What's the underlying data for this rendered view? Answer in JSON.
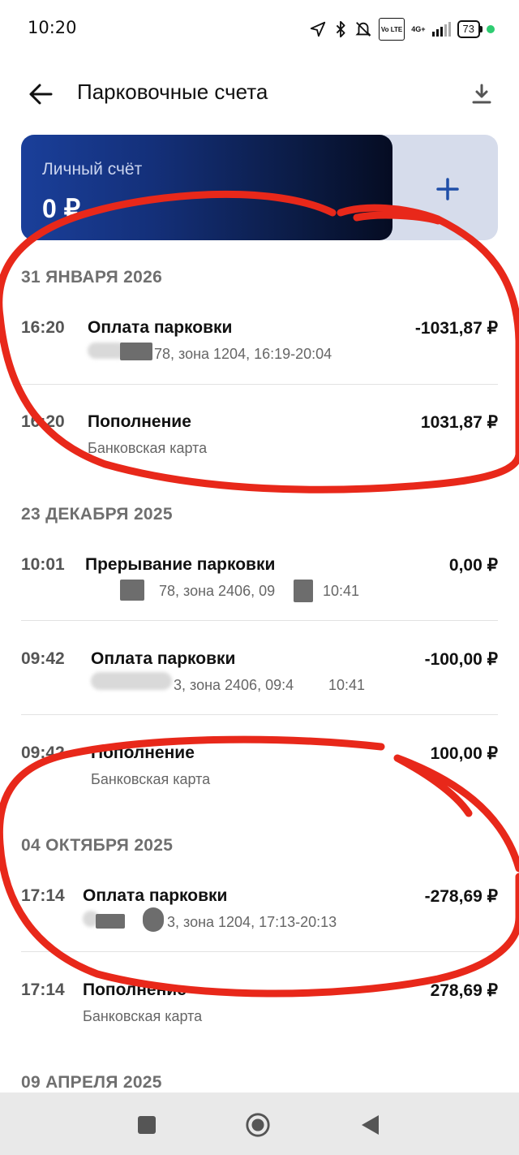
{
  "status_bar": {
    "time": "10:20",
    "lte_label": "Vo LTE",
    "network_label": "4G+",
    "battery": "73",
    "icons": [
      "location-icon",
      "bluetooth-icon",
      "bell-off-icon",
      "signal-icon",
      "battery-icon"
    ]
  },
  "header": {
    "title": "Парковочные счета"
  },
  "account_card": {
    "label": "Личный счёт",
    "balance": "0 ₽"
  },
  "transaction_groups": [
    {
      "date": "31 ЯНВАРЯ 2026",
      "items": [
        {
          "time": "16:20",
          "title": "Оплата парковки",
          "subtitle": "78, зона 1204, 16:19-20:04",
          "amount": "-1031,87 ₽"
        },
        {
          "time": "16:20",
          "title": "Пополнение",
          "subtitle": "Банковская карта",
          "amount": "1031,87 ₽"
        }
      ]
    },
    {
      "date": "23 ДЕКАБРЯ 2025",
      "items": [
        {
          "time": "10:01",
          "title": "Прерывание парковки",
          "subtitle": "78, зона 2406, 09",
          "subtitle_end": "10:41",
          "amount": "0,00 ₽"
        },
        {
          "time": "09:42",
          "title": "Оплата парковки",
          "subtitle": "3, зона 2406, 09:4",
          "subtitle_end": "10:41",
          "amount": "-100,00 ₽"
        },
        {
          "time": "09:42",
          "title": "Пополнение",
          "subtitle": "Банковская карта",
          "amount": "100,00 ₽"
        }
      ]
    },
    {
      "date": "04 ОКТЯБРЯ 2025",
      "items": [
        {
          "time": "17:14",
          "title": "Оплата парковки",
          "subtitle": "3, зона 1204, 17:13-20:13",
          "amount": "-278,69 ₽"
        },
        {
          "time": "17:14",
          "title": "Пополнение",
          "subtitle": "Банковская карта",
          "amount": "278,69 ₽"
        }
      ]
    },
    {
      "date": "09 АПРЕЛЯ 2025",
      "items": []
    }
  ],
  "colors": {
    "card_gradient_start": "#1a3f9a",
    "card_gradient_end": "#050c22",
    "add_button_bg": "#d6dceb",
    "plus_color": "#1f4ea8",
    "annotation_red": "#e8281a"
  }
}
